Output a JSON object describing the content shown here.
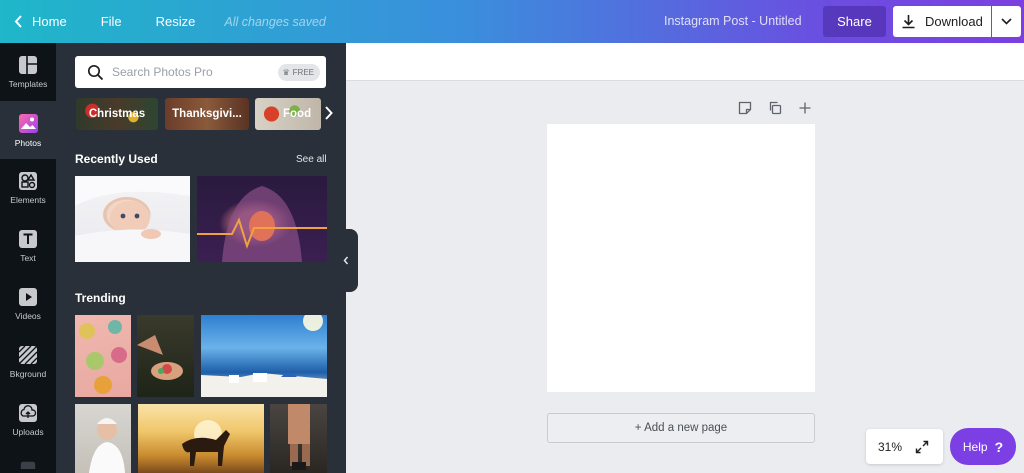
{
  "topbar": {
    "home": "Home",
    "file": "File",
    "resize": "Resize",
    "saved_status": "All changes saved",
    "doc_title": "Instagram Post - Untitled",
    "share": "Share",
    "download": "Download"
  },
  "sidenav": {
    "items": [
      {
        "label": "Templates",
        "icon": "templates-icon"
      },
      {
        "label": "Photos",
        "icon": "photos-icon"
      },
      {
        "label": "Elements",
        "icon": "elements-icon"
      },
      {
        "label": "Text",
        "icon": "text-icon"
      },
      {
        "label": "Videos",
        "icon": "videos-icon"
      },
      {
        "label": "Bkground",
        "icon": "background-icon"
      },
      {
        "label": "Uploads",
        "icon": "uploads-icon"
      }
    ],
    "active": "Photos"
  },
  "panel": {
    "search_placeholder": "Search Photos Pro",
    "free_badge": "FREE",
    "categories": [
      "Christmas",
      "Thanksgivi...",
      "Food"
    ],
    "recent_title": "Recently Used",
    "see_all": "See all",
    "trending_title": "Trending"
  },
  "canvas": {
    "add_page": "+ Add a new page",
    "zoom": "31%",
    "help": "Help",
    "help_icon": "?"
  },
  "colors": {
    "accent": "#7c3fe4",
    "panel_bg": "#293039",
    "nav_bg": "#0e1318"
  }
}
